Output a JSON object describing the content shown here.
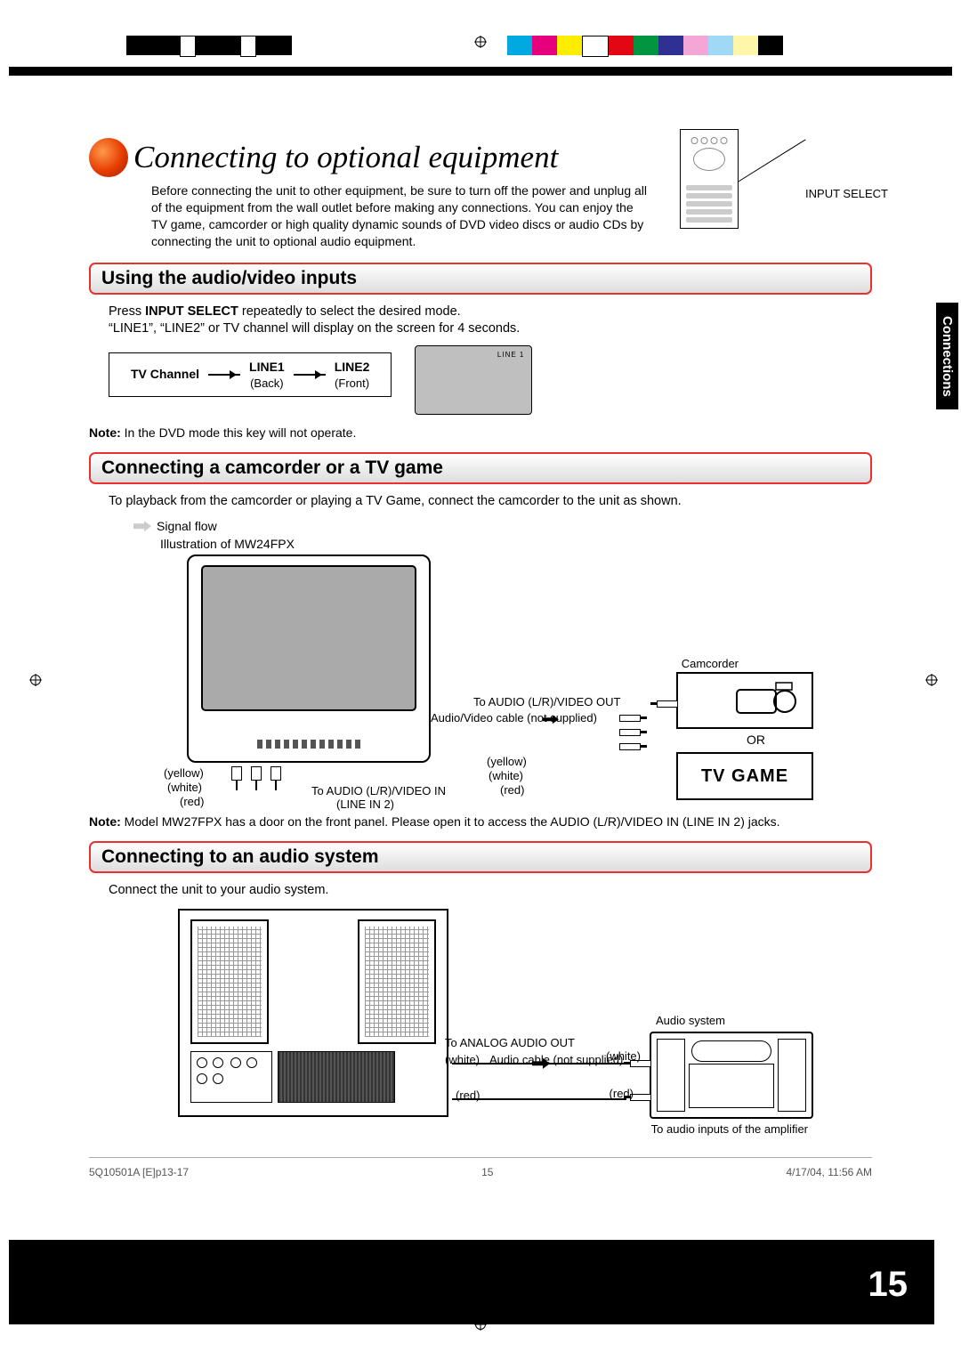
{
  "title": "Connecting to optional equipment",
  "intro": "Before connecting the unit to other equipment, be sure to turn off the power and unplug all of the equipment from the wall outlet before making any connections. You can enjoy the TV game, camcorder or high quality dynamic sounds of DVD video discs or audio CDs by connecting the unit to optional audio equipment.",
  "input_select": "INPUT SELECT",
  "side_tab": "Connections",
  "note_label": "Note:",
  "colors": {
    "yellow": "(yellow)",
    "white": "(white)",
    "red": "(red)"
  },
  "sections": [
    {
      "heading": "Using the audio/video inputs",
      "body_pre": "Press ",
      "body_bold": "INPUT SELECT",
      "body_post": " repeatedly to select the desired mode.",
      "body_line2": "“LINE1”, “LINE2” or TV channel will display on the screen for 4 seconds.",
      "modes": [
        "TV Channel",
        "LINE1",
        "LINE2"
      ],
      "subs": [
        "(Back)",
        "(Front)"
      ],
      "osd": "LINE 1",
      "note": " In the DVD mode this key will not operate."
    },
    {
      "heading": "Connecting a camcorder or a TV game",
      "body": "To playback from the camcorder or playing a TV Game, connect the camcorder to the unit as shown.",
      "signal_flow": "Signal flow",
      "illustration": "Illustration of MW24FPX",
      "to_audio_in": "To AUDIO (L/R)/VIDEO IN",
      "line_in": "(LINE IN 2)",
      "to_audio_out": "To AUDIO (L/R)/VIDEO OUT",
      "av_cable": "Audio/Video cable (not supplied)",
      "camcorder": "Camcorder",
      "or": "OR",
      "tv_game": "TV GAME",
      "note": " Model MW27FPX has a door on the front panel. Please open it to access the AUDIO (L/R)/VIDEO IN (LINE IN 2) jacks."
    },
    {
      "heading": "Connecting to an audio system",
      "body": "Connect the unit to your audio system.",
      "to_analog": "To ANALOG AUDIO OUT",
      "audio_cable": "Audio cable (not supplied)",
      "audio_system": "Audio system",
      "to_amp": "To audio inputs of the amplifier"
    }
  ],
  "page_number": "15",
  "footer": {
    "doc": "5Q10501A [E]p13-17",
    "page": "15",
    "date": "4/17/04, 11:56 AM"
  }
}
